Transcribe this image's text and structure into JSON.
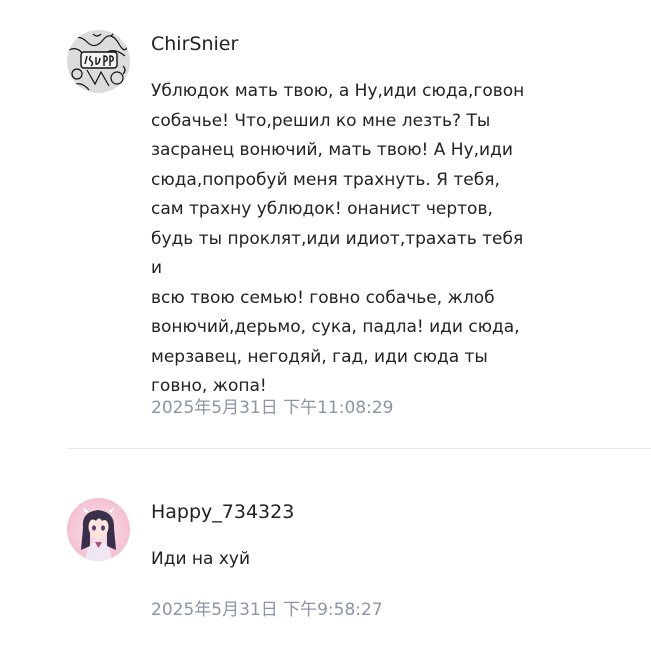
{
  "comments": [
    {
      "username": "ChirSnier",
      "avatar_icon": "graffiti-doodle-avatar",
      "text": "Ублюдок мать твою, а Ну,иди сюда,говон\nсобачье! Что,решил ко мне лезть? Ты\nзасранец вонючий, мать твою! А Ну,иди\nсюда,попробуй меня трахнуть. Я тебя,\nсам трахну ублюдок! онанист чертов,\nбудь ты проклят,иди идиот,трахать тебя и\nвсю твою семью! говно собачье, жлоб\nвонючий,дерьмо, сука, падла! иди сюда,\nмерзавец, негодяй, гад, иди сюда ты\nговно, жопа!",
      "timestamp": "2025年5月31日 下午11:08:29"
    },
    {
      "username": "Happy_734323",
      "avatar_icon": "anime-girl-avatar",
      "text": "Иди на хуй",
      "timestamp": "2025年5月31日 下午9:58:27"
    }
  ],
  "colors": {
    "text": "#222222",
    "timestamp": "#8a96a6",
    "divider": "#e8e8e8"
  }
}
